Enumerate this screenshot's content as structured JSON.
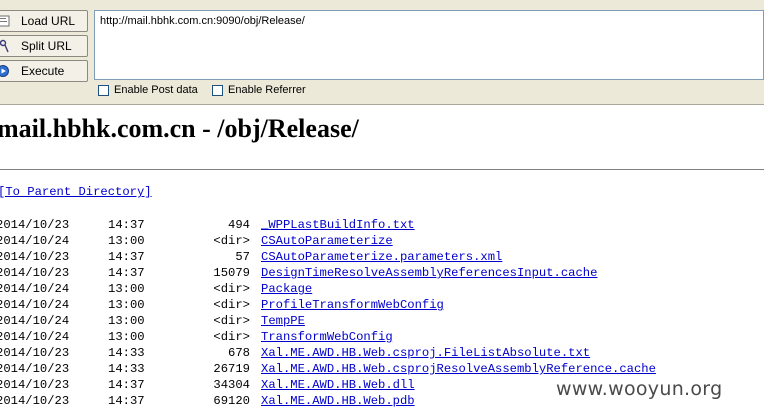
{
  "toolbar": {
    "load_url_label": "Load URL",
    "split_url_label": "Split URL",
    "execute_label": "Execute",
    "url_value": "http://mail.hbhk.com.cn:9090/obj/Release/",
    "enable_post_label": "Enable Post data",
    "enable_referrer_label": "Enable Referrer"
  },
  "page": {
    "title": "mail.hbhk.com.cn - /obj/Release/",
    "parent_link": "[To Parent Directory]"
  },
  "listing": [
    {
      "date": "2014/10/23",
      "time": "14:37",
      "size": "494",
      "name": "_WPPLastBuildInfo.txt"
    },
    {
      "date": "2014/10/24",
      "time": "13:00",
      "size": "<dir>",
      "name": "CSAutoParameterize"
    },
    {
      "date": "2014/10/23",
      "time": "14:37",
      "size": "57",
      "name": "CSAutoParameterize.parameters.xml"
    },
    {
      "date": "2014/10/23",
      "time": "14:37",
      "size": "15079",
      "name": "DesignTimeResolveAssemblyReferencesInput.cache"
    },
    {
      "date": "2014/10/24",
      "time": "13:00",
      "size": "<dir>",
      "name": "Package"
    },
    {
      "date": "2014/10/24",
      "time": "13:00",
      "size": "<dir>",
      "name": "ProfileTransformWebConfig"
    },
    {
      "date": "2014/10/24",
      "time": "13:00",
      "size": "<dir>",
      "name": "TempPE"
    },
    {
      "date": "2014/10/24",
      "time": "13:00",
      "size": "<dir>",
      "name": "TransformWebConfig"
    },
    {
      "date": "2014/10/23",
      "time": "14:33",
      "size": "678",
      "name": "Xal.ME.AWD.HB.Web.csproj.FileListAbsolute.txt"
    },
    {
      "date": "2014/10/23",
      "time": "14:33",
      "size": "26719",
      "name": "Xal.ME.AWD.HB.Web.csprojResolveAssemblyReference.cache"
    },
    {
      "date": "2014/10/23",
      "time": "14:37",
      "size": "34304",
      "name": "Xal.ME.AWD.HB.Web.dll"
    },
    {
      "date": "2014/10/23",
      "time": "14:37",
      "size": "69120",
      "name": "Xal.ME.AWD.HB.Web.pdb"
    }
  ],
  "watermark": "www.wooyun.org"
}
